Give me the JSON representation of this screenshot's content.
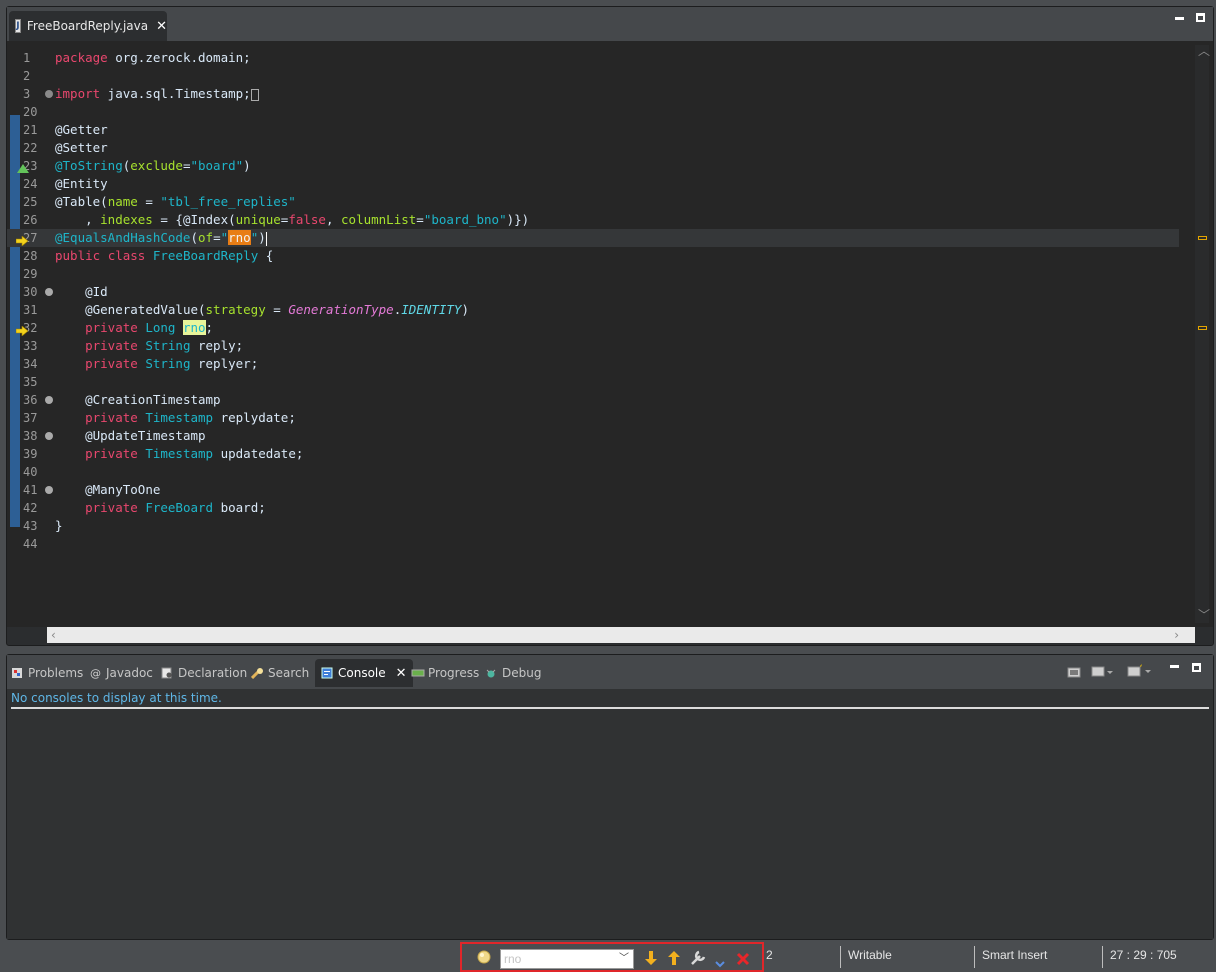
{
  "editor": {
    "tab_label": "FreeBoardReply.java",
    "file_icon_letter": "J",
    "lines": [
      {
        "n": "1",
        "tokens": [
          [
            "kw",
            "package"
          ],
          [
            "txt",
            " org.zerock.domain;"
          ]
        ]
      },
      {
        "n": "2",
        "tokens": []
      },
      {
        "n": "3",
        "tokens": [
          [
            "kw",
            "import"
          ],
          [
            "txt",
            " java.sql.Timestamp;"
          ],
          [
            "box",
            ""
          ]
        ],
        "fold": "plus"
      },
      {
        "n": "20",
        "tokens": []
      },
      {
        "n": "21",
        "tokens": [
          [
            "ann",
            "@Getter"
          ]
        ]
      },
      {
        "n": "22",
        "tokens": [
          [
            "ann",
            "@Setter"
          ]
        ]
      },
      {
        "n": "23",
        "tokens": [
          [
            "annsel",
            "@ToString"
          ],
          [
            "txt",
            "("
          ],
          [
            "attr",
            "exclude"
          ],
          [
            "txt",
            "="
          ],
          [
            "str",
            "\"board\""
          ],
          [
            "txt",
            ")"
          ]
        ],
        "marker": "warn"
      },
      {
        "n": "24",
        "tokens": [
          [
            "ann",
            "@Entity"
          ]
        ]
      },
      {
        "n": "25",
        "tokens": [
          [
            "ann",
            "@Table"
          ],
          [
            "txt",
            "("
          ],
          [
            "attr",
            "name"
          ],
          [
            "txt",
            " = "
          ],
          [
            "str",
            "\"tbl_free_replies\""
          ]
        ]
      },
      {
        "n": "26",
        "tokens": [
          [
            "txt",
            "    , "
          ],
          [
            "attr",
            "indexes"
          ],
          [
            "txt",
            " = {@Index("
          ],
          [
            "attr",
            "unique"
          ],
          [
            "txt",
            "="
          ],
          [
            "kw",
            "false"
          ],
          [
            "txt",
            ", "
          ],
          [
            "attr",
            "columnList"
          ],
          [
            "txt",
            "="
          ],
          [
            "str",
            "\"board_bno\""
          ],
          [
            "txt",
            ")})"
          ]
        ]
      },
      {
        "n": "27",
        "tokens": [
          [
            "annsel",
            "@EqualsAndHashCode"
          ],
          [
            "txt",
            "("
          ],
          [
            "attr",
            "of"
          ],
          [
            "txt",
            "="
          ],
          [
            "str",
            "\""
          ],
          [
            "hlo",
            "rno"
          ],
          [
            "str",
            "\""
          ],
          [
            "txt",
            ")"
          ]
        ],
        "marker": "arrow",
        "current": true
      },
      {
        "n": "28",
        "tokens": [
          [
            "kw",
            "public"
          ],
          [
            "txt",
            " "
          ],
          [
            "kw",
            "class"
          ],
          [
            "txt",
            " "
          ],
          [
            "type",
            "FreeBoardReply"
          ],
          [
            "txt",
            " {"
          ]
        ]
      },
      {
        "n": "29",
        "tokens": []
      },
      {
        "n": "30",
        "tokens": [
          [
            "txt",
            "    "
          ],
          [
            "ann",
            "@Id"
          ]
        ],
        "fold": "minus"
      },
      {
        "n": "31",
        "tokens": [
          [
            "txt",
            "    "
          ],
          [
            "ann",
            "@GeneratedValue"
          ],
          [
            "txt",
            "("
          ],
          [
            "attr",
            "strategy"
          ],
          [
            "txt",
            " = "
          ],
          [
            "ital",
            "GenerationType"
          ],
          [
            "txt",
            "."
          ],
          [
            "ital2",
            "IDENTITY"
          ],
          [
            "txt",
            ")"
          ]
        ]
      },
      {
        "n": "32",
        "tokens": [
          [
            "txt",
            "    "
          ],
          [
            "kw",
            "private"
          ],
          [
            "txt",
            " "
          ],
          [
            "type",
            "Long"
          ],
          [
            "txt",
            " "
          ],
          [
            "hly",
            "rno"
          ],
          [
            "txt",
            ";"
          ]
        ],
        "marker": "arrow"
      },
      {
        "n": "33",
        "tokens": [
          [
            "txt",
            "    "
          ],
          [
            "kw",
            "private"
          ],
          [
            "txt",
            " "
          ],
          [
            "type",
            "String"
          ],
          [
            "txt",
            " reply;"
          ]
        ]
      },
      {
        "n": "34",
        "tokens": [
          [
            "txt",
            "    "
          ],
          [
            "kw",
            "private"
          ],
          [
            "txt",
            " "
          ],
          [
            "type",
            "String"
          ],
          [
            "txt",
            " replyer;"
          ]
        ]
      },
      {
        "n": "35",
        "tokens": []
      },
      {
        "n": "36",
        "tokens": [
          [
            "txt",
            "    "
          ],
          [
            "ann",
            "@CreationTimestamp"
          ]
        ],
        "fold": "minus"
      },
      {
        "n": "37",
        "tokens": [
          [
            "txt",
            "    "
          ],
          [
            "kw",
            "private"
          ],
          [
            "txt",
            " "
          ],
          [
            "type",
            "Timestamp"
          ],
          [
            "txt",
            " replydate;"
          ]
        ]
      },
      {
        "n": "38",
        "tokens": [
          [
            "txt",
            "    "
          ],
          [
            "ann",
            "@UpdateTimestamp"
          ]
        ],
        "fold": "minus"
      },
      {
        "n": "39",
        "tokens": [
          [
            "txt",
            "    "
          ],
          [
            "kw",
            "private"
          ],
          [
            "txt",
            " "
          ],
          [
            "type",
            "Timestamp"
          ],
          [
            "txt",
            " updatedate;"
          ]
        ]
      },
      {
        "n": "40",
        "tokens": []
      },
      {
        "n": "41",
        "tokens": [
          [
            "txt",
            "    "
          ],
          [
            "ann",
            "@ManyToOne"
          ]
        ],
        "fold": "minus"
      },
      {
        "n": "42",
        "tokens": [
          [
            "txt",
            "    "
          ],
          [
            "kw",
            "private"
          ],
          [
            "txt",
            " "
          ],
          [
            "type",
            "FreeBoard"
          ],
          [
            "txt",
            " board;"
          ]
        ]
      },
      {
        "n": "43",
        "tokens": [
          [
            "txt",
            "}"
          ]
        ]
      },
      {
        "n": "44",
        "tokens": []
      }
    ]
  },
  "console_panel": {
    "tabs": [
      {
        "label": "Problems",
        "icon": "problems-icon",
        "active": false
      },
      {
        "label": "Javadoc",
        "icon": "javadoc-icon",
        "active": false
      },
      {
        "label": "Declaration",
        "icon": "declaration-icon",
        "active": false
      },
      {
        "label": "Search",
        "icon": "search-icon",
        "active": false
      },
      {
        "label": "Console",
        "icon": "console-icon",
        "active": true
      },
      {
        "label": "Progress",
        "icon": "progress-icon",
        "active": false
      },
      {
        "label": "Debug",
        "icon": "debug-icon",
        "active": false
      }
    ],
    "message": "No consoles to display at this time."
  },
  "statusbar": {
    "search_value": "rno",
    "match_count": "2",
    "writable": "Writable",
    "insert_mode": "Smart Insert",
    "position": "27 : 29 : 705"
  },
  "colors": {
    "keyword": "#e9476e",
    "string": "#1eb5c9",
    "attribute": "#a7e22e",
    "highlight_orange": "#e87d15",
    "highlight_yellow": "#e8f59a",
    "ruler_blue": "#2d5f95",
    "search_border": "#e0262a"
  }
}
